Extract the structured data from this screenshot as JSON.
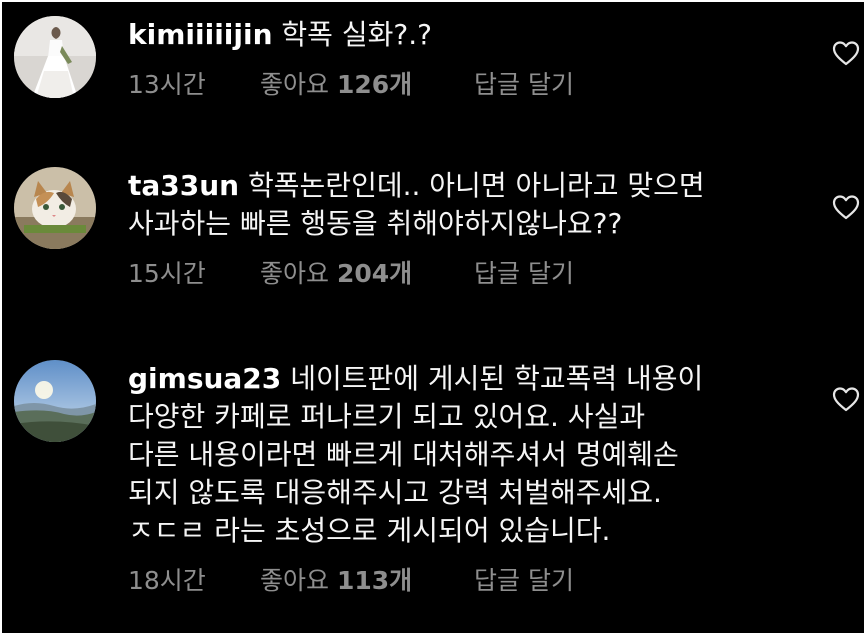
{
  "comments": [
    {
      "username": "kimiiiiijin",
      "text": "학폭 실화?.?",
      "time": "13시간",
      "likes_label": "좋아요",
      "likes_count": "126개",
      "reply_label": "답글 달기",
      "avatar": "bride-in-white-dress"
    },
    {
      "username": "ta33un",
      "text": "학폭논란인데.. 아니면 아니라고 맞으면\n사과하는 빠른 행동을 취해야하지않나요??",
      "time": "15시간",
      "likes_label": "좋아요",
      "likes_count": "204개",
      "reply_label": "답글 달기",
      "avatar": "cat"
    },
    {
      "username": "gimsua23",
      "text": "네이트판에 게시된 학교폭력 내용이\n다양한 카페로 퍼나르기 되고 있어요. 사실과\n다른 내용이라면 빠르게 대처해주셔서 명예훼손\n되지 않도록 대응해주시고 강력 처벌해주세요.\nㅈㄷㄹ 라는 초성으로 게시되어 있습니다.",
      "time": "18시간",
      "likes_label": "좋아요",
      "likes_count": "113개",
      "reply_label": "답글 달기",
      "avatar": "lake-landscape"
    }
  ],
  "icons": {
    "like": "heart-outline-icon"
  },
  "colors": {
    "background": "#000000",
    "text": "#f5f5f5",
    "meta": "#8e8e8e",
    "frame": "#ffffff"
  }
}
